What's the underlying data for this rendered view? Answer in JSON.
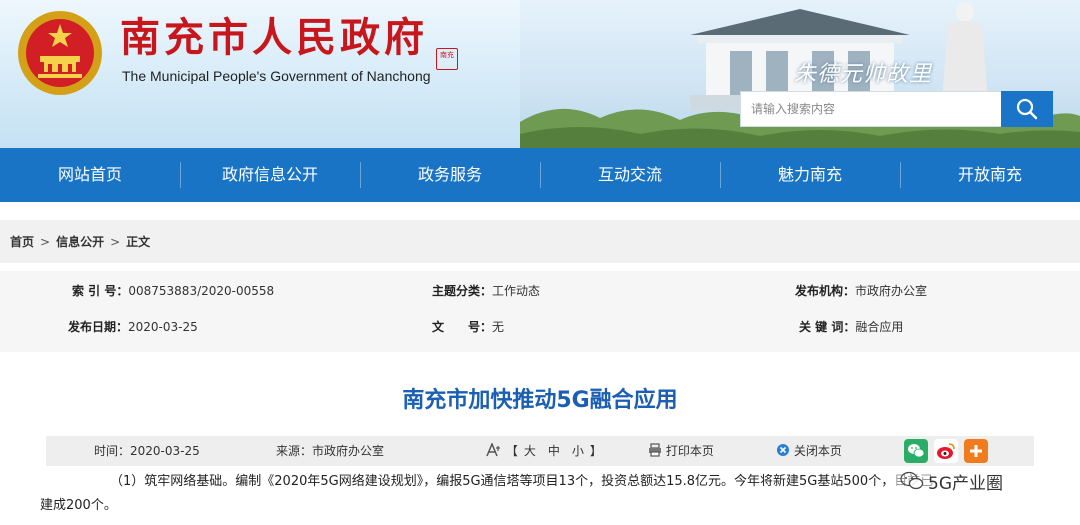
{
  "header": {
    "site_title_cn": "南充市人民政府",
    "site_title_en": "The Municipal People's Government of Nanchong",
    "seal_text": "南充",
    "calligraphy": "朱德元帅故里",
    "search_placeholder": "请输入搜索内容"
  },
  "nav": {
    "items": [
      "网站首页",
      "政府信息公开",
      "政务服务",
      "互动交流",
      "魅力南充",
      "开放南充"
    ]
  },
  "breadcrumb": {
    "home": "首页",
    "sep": ">",
    "section": "信息公开",
    "current": "正文"
  },
  "meta": {
    "index_label": "索 引 号：",
    "index_value": "008753883/2020-00558",
    "topic_label": "主题分类：",
    "topic_value": "工作动态",
    "publisher_label": "发布机构：",
    "publisher_value": "市政府办公室",
    "date_label": "发布日期：",
    "date_value": "2020-03-25",
    "doc_label": "文　　号：",
    "doc_value": "无",
    "keywords_label": "关 键 词：",
    "keywords_value": "融合应用"
  },
  "article": {
    "title": "南充市加快推动5G融合应用",
    "toolbar": {
      "time": "时间：2020-03-25",
      "source": "来源：市政府办公室",
      "font_prefix": "【",
      "font_large": "大",
      "font_medium": "中",
      "font_small": "小",
      "font_suffix": "】",
      "print": "打印本页",
      "close": "关闭本页"
    },
    "line1": "（1）筑牢网络基础。编制《2020年5G网络建设规划》，编报5G通信塔等项目13个，投资总额达15.8亿元。今年将新建5G基站500个，目前已",
    "line2": "建成200个。"
  },
  "watermark": {
    "text": "5G产业圈"
  },
  "colors": {
    "brand_red": "#c8161d",
    "nav_blue": "#1a74c6",
    "title_blue": "#1a5fb4",
    "wechat_green": "#2aae67",
    "weibo_red": "#e6162d",
    "share_orange": "#f07c1e"
  }
}
